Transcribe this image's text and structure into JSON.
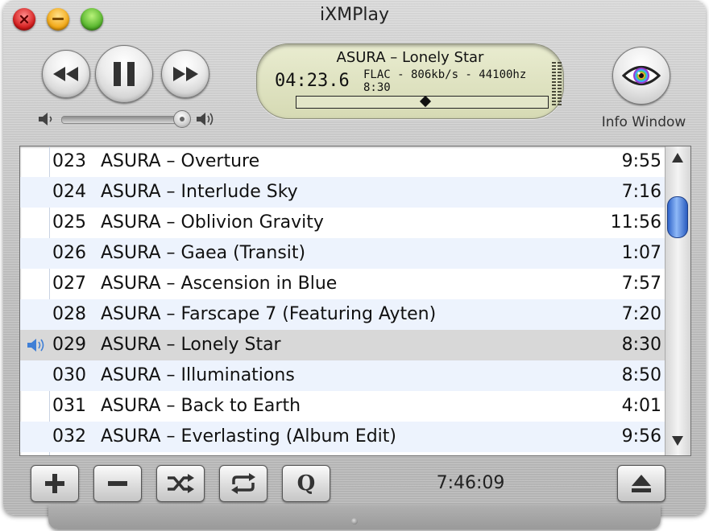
{
  "window": {
    "title": "iXMPlay"
  },
  "now_playing": {
    "title": "ASURA – Lonely Star",
    "elapsed": "04:23.6",
    "format": "FLAC - 806kb/s - 44100hz",
    "length": "8:30",
    "progress": 0.516
  },
  "volume": {
    "level": 0.99
  },
  "info_window": {
    "label": "Info Window"
  },
  "playlist": {
    "tracks": [
      {
        "num": "023",
        "name": "ASURA – Overture",
        "duration": "9:55"
      },
      {
        "num": "024",
        "name": "ASURA – Interlude Sky",
        "duration": "7:16"
      },
      {
        "num": "025",
        "name": "ASURA – Oblivion Gravity",
        "duration": "11:56"
      },
      {
        "num": "026",
        "name": "ASURA – Gaea (Transit)",
        "duration": "1:07"
      },
      {
        "num": "027",
        "name": "ASURA – Ascension in Blue",
        "duration": "7:57"
      },
      {
        "num": "028",
        "name": "ASURA – Farscape 7 (Featuring Ayten)",
        "duration": "7:20"
      },
      {
        "num": "029",
        "name": "ASURA – Lonely Star",
        "duration": "8:30"
      },
      {
        "num": "030",
        "name": "ASURA – Illuminations",
        "duration": "8:50"
      },
      {
        "num": "031",
        "name": "ASURA – Back to Earth",
        "duration": "4:01"
      },
      {
        "num": "032",
        "name": "ASURA – Everlasting (Album Edit)",
        "duration": "9:56"
      }
    ]
  },
  "toolbar": {
    "queue_label": "Q",
    "total_time": "7:46:09"
  },
  "colors": {
    "lcd_bg": "#dcdfbd",
    "selection": "#d8d8d8",
    "alt_row": "#edf3fd",
    "scroll_thumb": "#3b6fd6"
  }
}
